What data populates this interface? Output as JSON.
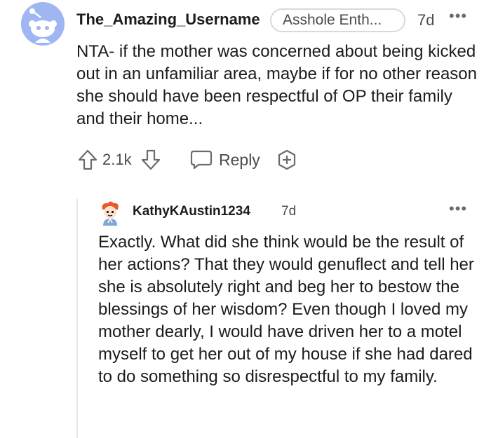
{
  "comment": {
    "username": "The_Amazing_Username",
    "flair": "Asshole Enth...",
    "time": "7d",
    "more": "•••",
    "body": "NTA- if the mother was concerned about being kicked out in an unfamiliar area, maybe if for no other reason she should have been respectful of OP their family and their home...",
    "score": "2.1k",
    "reply_label": "Reply"
  },
  "reply": {
    "username": "KathyKAustin1234",
    "time": "7d",
    "more": "•••",
    "body": "Exactly. What did she think would be the result of her actions? That they would genuflect and tell her she is absolutely right and beg her to bestow the blessings of her wisdom? Even though I loved my mother dearly, I would have driven her to a motel myself to get her out of my house if she had dared to do something so disrespectful to my family."
  },
  "icons": {
    "avatar_top": "snoo-avatar-icon",
    "upvote": "upvote-arrow-icon",
    "downvote": "downvote-arrow-icon",
    "reply": "speech-bubble-icon",
    "award": "award-plus-icon",
    "avatar_reply": "cartoon-avatar-icon"
  },
  "colors": {
    "avatar_bg": "#9fb6f2",
    "meta_gray": "#4a4b4d",
    "text": "#1c1c1c"
  }
}
